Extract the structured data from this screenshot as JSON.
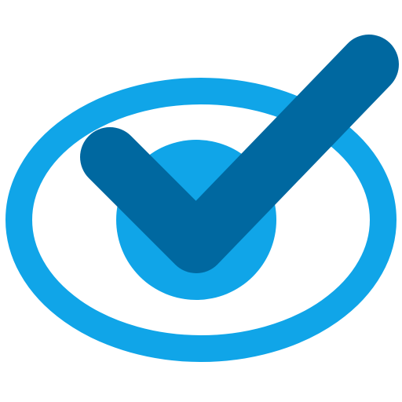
{
  "icon": {
    "name": "eye-check-icon",
    "colors": {
      "ring": "#10A5E8",
      "pupil": "#10A5E8",
      "check": "#0068A0",
      "background": "#FFFFFF"
    }
  }
}
